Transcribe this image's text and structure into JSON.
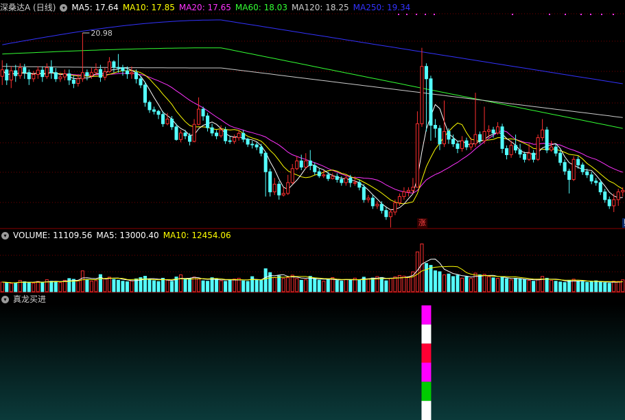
{
  "colors": {
    "background": "#000000",
    "up": "#ff3030",
    "down": "#54ffff",
    "grid": "#7a0000",
    "ma5": "#ffffff",
    "ma10": "#ffff00",
    "ma20": "#ff33ff",
    "ma60": "#33ff33",
    "ma120": "#cccccc",
    "ma250": "#3333ff",
    "label": "#cfcfcf"
  },
  "price_panel": {
    "title": "深桑达A (日线)",
    "menu_icon": "chevron-down-icon",
    "legend": [
      {
        "name": "MA5",
        "text": "MA5: 17.64",
        "color": "#ffffff"
      },
      {
        "name": "MA10",
        "text": "MA10: 17.85",
        "color": "#ffff00"
      },
      {
        "name": "MA20",
        "text": "MA20: 17.65",
        "color": "#ff33ff"
      },
      {
        "name": "MA60",
        "text": "MA60: 18.03",
        "color": "#33ff33"
      },
      {
        "name": "MA120",
        "text": "MA120: 18.25",
        "color": "#cccccc"
      },
      {
        "name": "MA250",
        "text": "MA250: 19.34",
        "color": "#3333ff"
      }
    ],
    "high_label": "20.98",
    "markers": {
      "zhang": "涨",
      "cai": "财"
    }
  },
  "volume_panel": {
    "legend": [
      {
        "name": "VOLUME",
        "text": "VOLUME: 11109.56",
        "color": "#ffffff"
      },
      {
        "name": "MA5",
        "text": "MA5: 13000.40",
        "color": "#ffffff"
      },
      {
        "name": "MA10",
        "text": "MA10: 12454.06",
        "color": "#ffff00"
      }
    ]
  },
  "indicator_panel": {
    "title": "真龙买进",
    "signal_colors": [
      "#ff00ff",
      "#ffffff",
      "#ff0033",
      "#ff00ff",
      "#00cc00",
      "#ffffff"
    ]
  },
  "chart_data": {
    "type": "candlestick",
    "candles": [
      [
        19.58,
        19.79,
        20.1,
        19.3
      ],
      [
        19.79,
        19.46,
        20.0,
        19.3
      ],
      [
        19.46,
        19.76,
        19.9,
        19.2
      ],
      [
        19.76,
        19.6,
        19.95,
        19.4
      ],
      [
        19.6,
        19.86,
        20.0,
        19.5
      ],
      [
        19.86,
        19.7,
        19.98,
        19.5
      ],
      [
        19.7,
        19.5,
        19.8,
        19.3
      ],
      [
        19.5,
        19.64,
        19.75,
        19.4
      ],
      [
        19.64,
        19.78,
        19.9,
        19.5
      ],
      [
        19.78,
        19.57,
        19.9,
        19.4
      ],
      [
        19.57,
        19.86,
        20.0,
        19.5
      ],
      [
        19.86,
        19.7,
        20.1,
        19.5
      ],
      [
        19.7,
        19.5,
        19.85,
        19.4
      ],
      [
        19.5,
        19.56,
        19.7,
        19.4
      ],
      [
        19.56,
        19.66,
        19.8,
        19.45
      ],
      [
        19.66,
        19.46,
        19.8,
        19.3
      ],
      [
        19.46,
        19.35,
        19.6,
        19.2
      ],
      [
        19.35,
        19.5,
        19.65,
        19.25
      ],
      [
        19.5,
        19.7,
        20.98,
        19.4
      ],
      [
        19.7,
        19.6,
        19.8,
        19.45
      ],
      [
        19.6,
        19.7,
        19.85,
        19.5
      ],
      [
        19.7,
        19.8,
        20.0,
        19.6
      ],
      [
        19.8,
        19.55,
        19.95,
        19.4
      ],
      [
        19.55,
        19.73,
        19.85,
        19.45
      ],
      [
        19.73,
        20.05,
        20.2,
        19.7
      ],
      [
        20.05,
        19.87,
        20.1,
        19.7
      ],
      [
        19.87,
        19.86,
        20.3,
        19.7
      ],
      [
        19.86,
        19.76,
        19.95,
        19.6
      ],
      [
        19.76,
        19.66,
        19.9,
        19.5
      ],
      [
        19.66,
        19.7,
        19.9,
        19.5
      ],
      [
        19.7,
        19.5,
        19.8,
        19.35
      ],
      [
        19.5,
        19.3,
        19.6,
        19.2
      ],
      [
        19.3,
        18.74,
        19.4,
        18.6
      ],
      [
        18.74,
        18.5,
        18.8,
        18.4
      ],
      [
        18.5,
        18.45,
        18.6,
        18.35
      ],
      [
        18.45,
        18.35,
        18.5,
        18.2
      ],
      [
        18.35,
        18.05,
        18.45,
        17.95
      ],
      [
        18.05,
        18.2,
        18.4,
        18.0
      ],
      [
        18.2,
        17.95,
        18.3,
        17.85
      ],
      [
        17.95,
        17.54,
        18.05,
        17.5
      ],
      [
        17.54,
        17.75,
        17.85,
        17.45
      ],
      [
        17.75,
        17.66,
        17.85,
        17.55
      ],
      [
        17.66,
        17.48,
        17.75,
        17.35
      ],
      [
        17.48,
        18.03,
        18.2,
        17.45
      ],
      [
        18.03,
        18.52,
        18.9,
        18.0
      ],
      [
        18.52,
        18.3,
        18.6,
        18.15
      ],
      [
        18.3,
        17.92,
        18.4,
        17.8
      ],
      [
        17.92,
        17.75,
        18.05,
        17.65
      ],
      [
        17.75,
        17.66,
        17.85,
        17.55
      ],
      [
        17.66,
        17.85,
        18.0,
        17.6
      ],
      [
        17.85,
        17.5,
        17.95,
        17.4
      ],
      [
        17.5,
        17.48,
        17.65,
        17.4
      ],
      [
        17.48,
        17.6,
        17.7,
        17.4
      ],
      [
        17.6,
        17.74,
        17.85,
        17.5
      ],
      [
        17.74,
        17.55,
        17.85,
        17.45
      ],
      [
        17.55,
        17.39,
        17.6,
        17.3
      ],
      [
        17.39,
        17.37,
        17.5,
        17.25
      ],
      [
        17.37,
        17.3,
        17.45,
        17.2
      ],
      [
        17.3,
        17.1,
        17.4,
        17.0
      ],
      [
        17.1,
        16.5,
        17.15,
        15.7
      ],
      [
        16.5,
        15.85,
        16.6,
        15.7
      ],
      [
        15.85,
        16.1,
        16.3,
        15.75
      ],
      [
        16.1,
        15.75,
        16.2,
        15.6
      ],
      [
        15.75,
        15.8,
        16.0,
        15.7
      ],
      [
        15.8,
        16.15,
        16.4,
        15.75
      ],
      [
        16.15,
        16.6,
        16.75,
        16.1
      ],
      [
        16.6,
        16.85,
        17.0,
        16.55
      ],
      [
        16.85,
        16.65,
        17.05,
        16.55
      ],
      [
        16.65,
        16.85,
        17.1,
        16.6
      ],
      [
        16.85,
        16.7,
        17.2,
        16.55
      ],
      [
        16.7,
        16.5,
        16.8,
        16.4
      ],
      [
        16.5,
        16.37,
        16.6,
        16.3
      ],
      [
        16.37,
        16.4,
        16.55,
        16.3
      ],
      [
        16.4,
        16.28,
        16.5,
        16.2
      ],
      [
        16.28,
        16.35,
        16.45,
        16.25
      ],
      [
        16.35,
        16.25,
        16.45,
        16.15
      ],
      [
        16.25,
        16.15,
        16.35,
        16.05
      ],
      [
        16.15,
        16.3,
        16.4,
        16.05
      ],
      [
        16.3,
        16.15,
        16.4,
        16.0
      ],
      [
        16.15,
        16.15,
        16.35,
        16.05
      ],
      [
        16.15,
        16.0,
        16.25,
        15.9
      ],
      [
        16.0,
        15.6,
        16.1,
        15.5
      ],
      [
        15.6,
        15.65,
        15.75,
        15.5
      ],
      [
        15.65,
        15.4,
        15.75,
        15.3
      ],
      [
        15.4,
        15.45,
        15.55,
        15.3
      ],
      [
        15.45,
        15.25,
        15.55,
        15.15
      ],
      [
        15.25,
        15.05,
        15.35,
        14.95
      ],
      [
        15.05,
        15.2,
        15.3,
        14.7
      ],
      [
        15.2,
        15.5,
        15.6,
        15.1
      ],
      [
        15.5,
        15.7,
        15.8,
        15.4
      ],
      [
        15.7,
        15.85,
        16.0,
        15.6
      ],
      [
        15.85,
        15.9,
        16.0,
        15.7
      ],
      [
        15.9,
        16.0,
        16.3,
        15.8
      ],
      [
        16.0,
        18.05,
        18.45,
        16.0
      ],
      [
        18.05,
        19.9,
        20.5,
        17.95
      ],
      [
        19.9,
        19.5,
        20.0,
        17.8
      ],
      [
        19.5,
        18.0,
        19.6,
        17.5
      ],
      [
        18.0,
        17.9,
        18.2,
        17.6
      ],
      [
        17.9,
        17.4,
        18.0,
        17.2
      ],
      [
        17.4,
        17.8,
        18.8,
        17.3
      ],
      [
        17.8,
        17.55,
        17.9,
        17.4
      ],
      [
        17.55,
        17.4,
        17.7,
        17.3
      ],
      [
        17.4,
        17.25,
        17.5,
        17.1
      ],
      [
        17.25,
        17.5,
        17.65,
        17.15
      ],
      [
        17.5,
        17.3,
        17.6,
        17.2
      ],
      [
        17.3,
        17.4,
        17.6,
        17.2
      ],
      [
        17.4,
        17.7,
        19.05,
        17.3
      ],
      [
        17.7,
        17.5,
        17.8,
        17.4
      ],
      [
        17.5,
        17.8,
        18.6,
        17.4
      ],
      [
        17.8,
        17.85,
        18.0,
        17.6
      ],
      [
        17.85,
        17.75,
        17.95,
        17.6
      ],
      [
        17.75,
        17.95,
        18.1,
        17.7
      ],
      [
        17.95,
        17.25,
        18.05,
        17.1
      ],
      [
        17.25,
        17.05,
        17.35,
        16.9
      ],
      [
        17.05,
        17.35,
        17.5,
        16.95
      ],
      [
        17.35,
        17.2,
        17.7,
        17.1
      ],
      [
        17.2,
        17.07,
        17.4,
        16.95
      ],
      [
        17.07,
        16.9,
        17.15,
        16.8
      ],
      [
        16.9,
        17.1,
        17.4,
        16.85
      ],
      [
        17.1,
        16.9,
        17.2,
        16.8
      ],
      [
        16.9,
        17.6,
        17.7,
        16.85
      ],
      [
        17.6,
        17.85,
        18.2,
        17.5
      ],
      [
        17.85,
        17.2,
        17.95,
        17.1
      ],
      [
        17.2,
        17.3,
        17.5,
        17.15
      ],
      [
        17.3,
        17.1,
        17.4,
        17.0
      ],
      [
        17.1,
        16.8,
        17.2,
        16.7
      ],
      [
        16.8,
        16.52,
        16.9,
        16.4
      ],
      [
        16.52,
        16.25,
        16.6,
        15.8
      ],
      [
        16.25,
        16.9,
        17.0,
        16.2
      ],
      [
        16.9,
        16.72,
        17.0,
        16.6
      ],
      [
        16.72,
        16.5,
        16.8,
        16.4
      ],
      [
        16.5,
        16.4,
        16.6,
        16.3
      ],
      [
        16.4,
        16.2,
        16.5,
        16.1
      ],
      [
        16.2,
        16.15,
        16.3,
        16.05
      ],
      [
        16.15,
        15.85,
        16.25,
        15.75
      ],
      [
        15.85,
        15.6,
        15.95,
        15.5
      ],
      [
        15.6,
        15.4,
        15.7,
        15.3
      ],
      [
        15.4,
        15.6,
        15.8,
        15.2
      ],
      [
        15.6,
        15.85,
        15.95,
        15.4
      ],
      [
        15.85,
        15.9,
        16.0,
        15.7
      ]
    ],
    "volume": [
      9000,
      8500,
      7800,
      8200,
      10500,
      9300,
      8700,
      8100,
      9600,
      8900,
      11200,
      9800,
      9000,
      8600,
      10700,
      12300,
      11600,
      10200,
      19500,
      11300,
      9900,
      10400,
      16000,
      12100,
      13600,
      11500,
      10800,
      9800,
      9300,
      10100,
      12000,
      13200,
      14500,
      11200,
      10300,
      9500,
      12600,
      10900,
      9700,
      13800,
      15800,
      11600,
      12300,
      13700,
      11900,
      10200,
      9800,
      13100,
      12200,
      10300,
      9700,
      10800,
      11800,
      12600,
      10100,
      9600,
      14100,
      11200,
      10600,
      21500,
      17900,
      13200,
      14800,
      12400,
      13100,
      15500,
      12300,
      10700,
      11200,
      14400,
      12600,
      10800,
      9800,
      11600,
      13200,
      10500,
      9900,
      11400,
      10900,
      12700,
      11300,
      13600,
      12000,
      12800,
      14200,
      13300,
      10200,
      12500,
      13900,
      15200,
      14600,
      13800,
      18600,
      37300,
      44800,
      26500,
      24700,
      19600,
      18700,
      15800,
      16600,
      14200,
      15400,
      12700,
      13900,
      12400,
      17400,
      15800,
      16300,
      14100,
      13000,
      12500,
      13800,
      12200,
      11100,
      12600,
      11800,
      11200,
      10600,
      9800,
      11600,
      14300,
      12600,
      10500,
      9800,
      9100,
      8600,
      10400,
      11700,
      9900,
      9200,
      8800,
      9500,
      10200,
      8900,
      8400,
      7900,
      9800,
      9600,
      11100
    ],
    "ylim": [
      15.0,
      21.6
    ],
    "volume_max": 47000,
    "ma_periods": {
      "MA5": 5,
      "MA10": 10,
      "MA20": 20,
      "MA60": 60,
      "MA120": 120,
      "MA250": 250
    },
    "extra_ma": [
      {
        "name": "MA60",
        "values_start": 20.3,
        "values_peak": 20.5,
        "values_end": 17.9
      },
      {
        "name": "MA120",
        "values_start": 19.9,
        "values_peak": 19.85,
        "values_end": 18.25
      },
      {
        "name": "MA250",
        "values_start": 20.6,
        "values_peak": 21.4,
        "values_end": 19.34
      }
    ],
    "signal_candle_index": 95,
    "signal_levels": [
      6,
      5,
      4,
      3,
      2,
      1
    ],
    "grid": true,
    "legend": "top-left"
  }
}
